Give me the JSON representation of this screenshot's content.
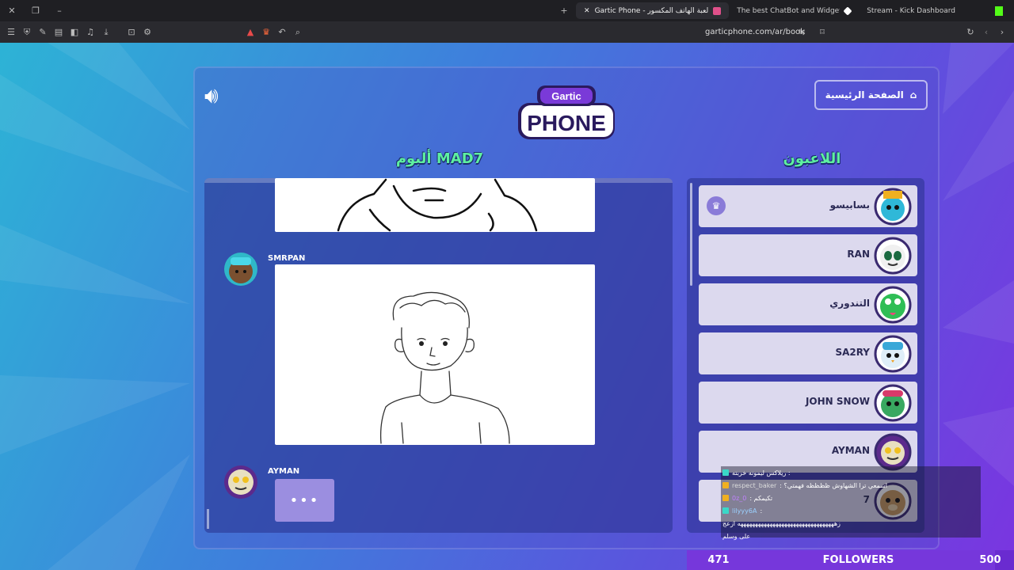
{
  "browser": {
    "tabs": [
      {
        "label": "Gartic Phone - لعبة الهاتف المكسور",
        "active": true,
        "color": "#e0508a"
      },
      {
        "label": "The best ChatBot and Widgets for Kick",
        "active": false,
        "color": "#ffffff"
      },
      {
        "label": "Stream - Kick Dashboard",
        "active": false,
        "color": "#53fc18"
      }
    ],
    "url": "garticphone.com/ar/book"
  },
  "page": {
    "home_label": "الصفحة الرئيسية",
    "album_title": "ألبوم MAD7",
    "players_title": "اللاعبون",
    "logo_top": "Gartic",
    "logo_bottom": "PHONE",
    "typing_dots": "•••",
    "entries": [
      {
        "author": "SMRPAN"
      },
      {
        "author": "AYMAN"
      }
    ]
  },
  "players": [
    {
      "name": "بسابيسو",
      "host": true,
      "color": "#2fb8d8"
    },
    {
      "name": "RAN",
      "host": false,
      "color": "#2e8a5a"
    },
    {
      "name": "التندوري",
      "host": false,
      "color": "#2fbe55"
    },
    {
      "name": "SA2RY",
      "host": false,
      "color": "#3aa8d8"
    },
    {
      "name": "JOHN SNOW",
      "host": false,
      "color": "#39a860"
    },
    {
      "name": "AYMAN",
      "host": false,
      "color": "#5c2a8c"
    },
    {
      "name": "7",
      "host": false,
      "color": "#c89a5a"
    }
  ],
  "chat": [
    {
      "user": "",
      "text": "ريلاكس ليمونه خربته :"
    },
    {
      "user": "respect_baker",
      "text": ": اسمعي ترا الشهاوش ظظظظه فهمتي؟"
    },
    {
      "user": "0z_0",
      "text": ": تكيمكم"
    },
    {
      "user": "lilyyy6A",
      "text": ":"
    },
    {
      "user": "",
      "text": "زهههههههههههههههههههههههههههههههههه ازعج"
    },
    {
      "user": "",
      "text": "على وسلم"
    }
  ],
  "followers": {
    "current": "471",
    "label": "FOLLOWERS",
    "goal": "500",
    "progress": 0.942
  }
}
